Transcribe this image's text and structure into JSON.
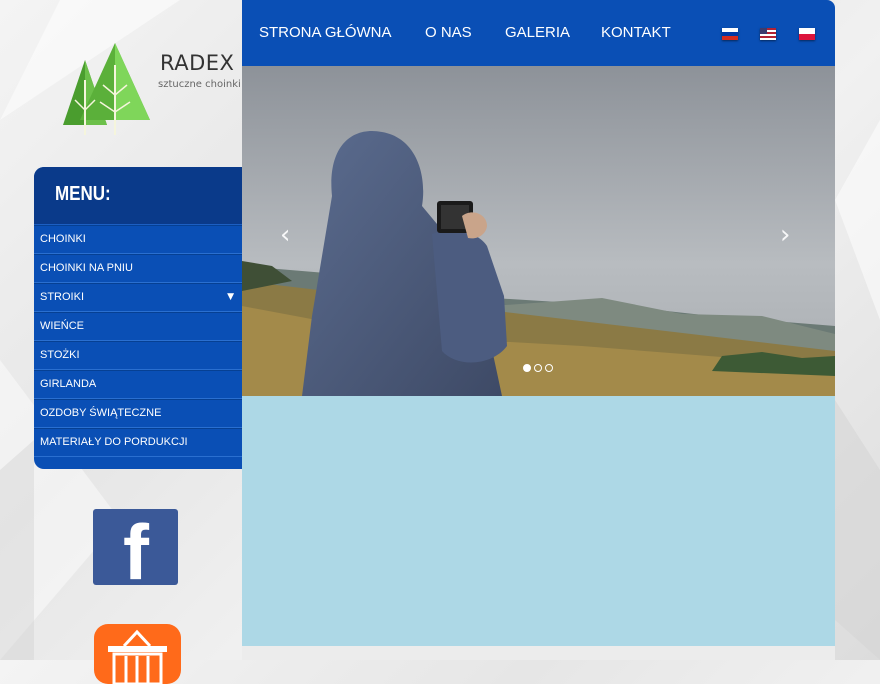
{
  "brand": {
    "name": "RADEX",
    "tagline": "sztuczne choinki"
  },
  "menu": {
    "title": "MENU:",
    "items": [
      {
        "label": "CHOINKI",
        "has_submenu": false
      },
      {
        "label": "CHOINKI NA PNIU",
        "has_submenu": false
      },
      {
        "label": "STROIKI",
        "has_submenu": true
      },
      {
        "label": "WIEŃCE",
        "has_submenu": false
      },
      {
        "label": "STOŻKI",
        "has_submenu": false
      },
      {
        "label": "GIRLANDA",
        "has_submenu": false
      },
      {
        "label": "OZDOBY ŚWIĄTECZNE",
        "has_submenu": false
      },
      {
        "label": "MATERIAŁY DO PORDUKCJI",
        "has_submenu": false
      }
    ],
    "caret": "▼"
  },
  "nav": {
    "links": [
      {
        "label": "STRONA GŁÓWNA"
      },
      {
        "label": "O NAS"
      },
      {
        "label": "GALERIA"
      },
      {
        "label": "KONTAKT"
      }
    ],
    "flags": [
      "russia-flag-icon",
      "usa-flag-icon",
      "poland-flag-icon"
    ]
  },
  "slider": {
    "prev": "‹",
    "next": "›",
    "slide_count": 3,
    "active_index": 0
  },
  "social": {
    "facebook_letter": "f",
    "icons": [
      "facebook-icon",
      "shopping-basket-icon"
    ]
  },
  "colors": {
    "primary_blue": "#0a4fb5",
    "menu_header_blue": "#0a3a8a",
    "content_light_blue": "#add8e6",
    "facebook_blue": "#3b5998",
    "shop_orange": "#ff6a1a"
  }
}
